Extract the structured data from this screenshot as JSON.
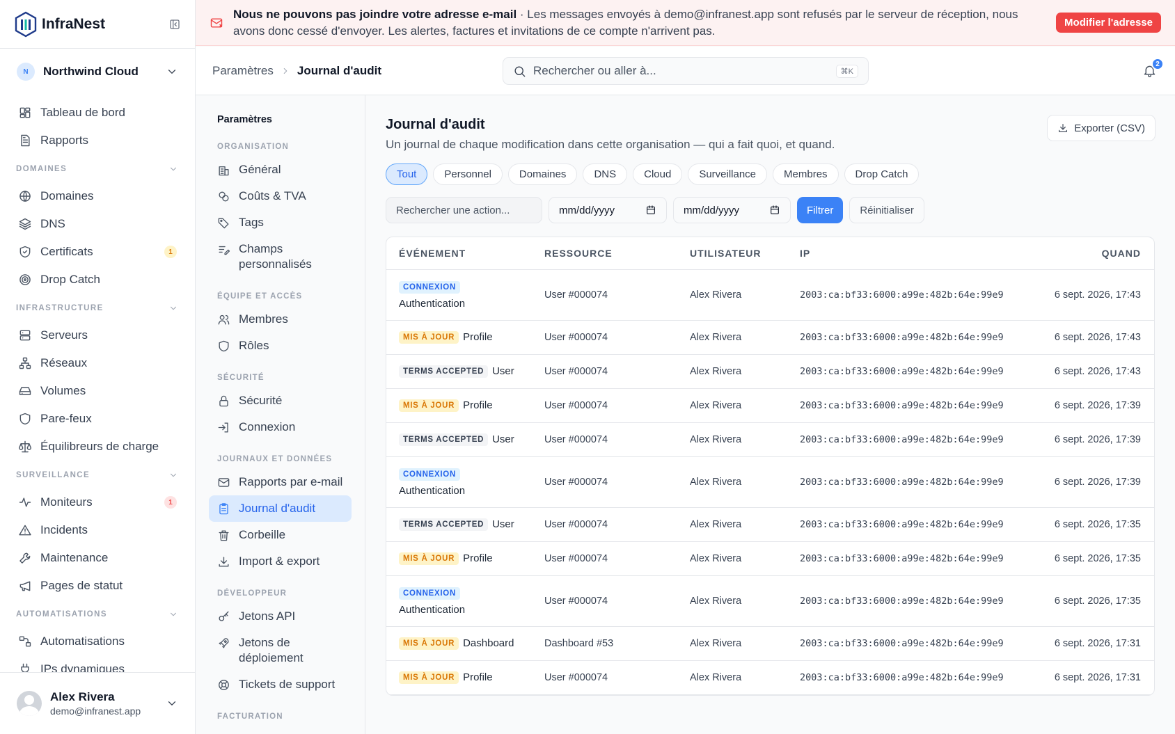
{
  "app": {
    "name": "InfraNest"
  },
  "org": {
    "initial": "N",
    "name": "Northwind Cloud"
  },
  "sidebar": {
    "top": [
      {
        "label": "Tableau de bord",
        "icon": "dashboard-icon"
      },
      {
        "label": "Rapports",
        "icon": "report-icon"
      }
    ],
    "sections": [
      {
        "title": "DOMAINES",
        "items": [
          {
            "label": "Domaines",
            "icon": "globe-icon"
          },
          {
            "label": "DNS",
            "icon": "layers-icon"
          },
          {
            "label": "Certificats",
            "icon": "shield-check-icon",
            "badge": "1",
            "badge_color": "amber"
          },
          {
            "label": "Drop Catch",
            "icon": "target-icon"
          }
        ]
      },
      {
        "title": "INFRASTRUCTURE",
        "items": [
          {
            "label": "Serveurs",
            "icon": "server-icon"
          },
          {
            "label": "Réseaux",
            "icon": "network-icon"
          },
          {
            "label": "Volumes",
            "icon": "drive-icon"
          },
          {
            "label": "Pare-feux",
            "icon": "shield-icon"
          },
          {
            "label": "Équilibreurs de charge",
            "icon": "scale-icon"
          }
        ]
      },
      {
        "title": "SURVEILLANCE",
        "items": [
          {
            "label": "Moniteurs",
            "icon": "activity-icon",
            "badge": "1",
            "badge_color": "red"
          },
          {
            "label": "Incidents",
            "icon": "warning-icon"
          },
          {
            "label": "Maintenance",
            "icon": "wrench-icon"
          },
          {
            "label": "Pages de statut",
            "icon": "megaphone-icon"
          }
        ]
      },
      {
        "title": "AUTOMATISATIONS",
        "items": [
          {
            "label": "Automatisations",
            "icon": "workflow-icon"
          },
          {
            "label": "IPs dynamiques",
            "icon": "plug-icon"
          }
        ]
      }
    ]
  },
  "user": {
    "name": "Alex Rivera",
    "email": "demo@infranest.app"
  },
  "banner": {
    "title": "Nous ne pouvons pas joindre votre adresse e-mail",
    "message": " · Les messages envoyés à demo@infranest.app sont refusés par le serveur de réception, nous avons donc cessé d'envoyer. Les alertes, factures et invitations de ce compte n'arrivent pas.",
    "button": "Modifier l'adresse"
  },
  "breadcrumb": {
    "parent": "Paramètres",
    "current": "Journal d'audit"
  },
  "search": {
    "placeholder": "Rechercher ou aller à...",
    "shortcut": "⌘K"
  },
  "notifications": {
    "count": "2"
  },
  "settings_nav": {
    "title": "Paramètres",
    "groups": [
      {
        "title": "ORGANISATION",
        "items": [
          {
            "label": "Général",
            "icon": "building-icon"
          },
          {
            "label": "Coûts & TVA",
            "icon": "coins-icon"
          },
          {
            "label": "Tags",
            "icon": "tag-icon"
          },
          {
            "label": "Champs personnalisés",
            "icon": "list-edit-icon"
          }
        ]
      },
      {
        "title": "ÉQUIPE ET ACCÈS",
        "items": [
          {
            "label": "Membres",
            "icon": "users-icon"
          },
          {
            "label": "Rôles",
            "icon": "shield-icon"
          }
        ]
      },
      {
        "title": "SÉCURITÉ",
        "items": [
          {
            "label": "Sécurité",
            "icon": "lock-icon"
          },
          {
            "label": "Connexion",
            "icon": "login-icon"
          }
        ]
      },
      {
        "title": "JOURNAUX ET DONNÉES",
        "items": [
          {
            "label": "Rapports par e-mail",
            "icon": "mail-icon"
          },
          {
            "label": "Journal d'audit",
            "icon": "clipboard-icon",
            "active": true
          },
          {
            "label": "Corbeille",
            "icon": "trash-icon"
          },
          {
            "label": "Import & export",
            "icon": "download-icon"
          }
        ]
      },
      {
        "title": "DÉVELOPPEUR",
        "items": [
          {
            "label": "Jetons API",
            "icon": "key-icon"
          },
          {
            "label": "Jetons de déploiement",
            "icon": "rocket-icon"
          },
          {
            "label": "Tickets de support",
            "icon": "lifebuoy-icon"
          }
        ]
      },
      {
        "title": "FACTURATION",
        "items": []
      }
    ]
  },
  "page": {
    "title": "Journal d'audit",
    "description": "Un journal de chaque modification dans cette organisation — qui a fait quoi, et quand.",
    "export_label": "Exporter (CSV)"
  },
  "chips": [
    {
      "label": "Tout",
      "active": true
    },
    {
      "label": "Personnel"
    },
    {
      "label": "Domaines"
    },
    {
      "label": "DNS"
    },
    {
      "label": "Cloud"
    },
    {
      "label": "Surveillance"
    },
    {
      "label": "Membres"
    },
    {
      "label": "Drop Catch"
    }
  ],
  "filters": {
    "action_placeholder": "Rechercher une action...",
    "date_from": "mm/dd/yyyy",
    "date_to": "mm/dd/yyyy",
    "filter_label": "Filtrer",
    "reset_label": "Réinitialiser"
  },
  "table": {
    "headers": {
      "event": "ÉVÉNEMENT",
      "resource": "RESSOURCE",
      "user": "UTILISATEUR",
      "ip": "IP",
      "when": "QUAND"
    },
    "rows": [
      {
        "tag": "CONNEXION",
        "kind": "login",
        "subject": "Authentication",
        "resource": "User #000074",
        "user": "Alex Rivera",
        "ip": "2003:ca:bf33:6000:a99e:482b:64e:99e9",
        "when": "6 sept. 2026, 17:43"
      },
      {
        "tag": "MIS À JOUR",
        "kind": "update",
        "subject": "Profile",
        "resource": "User #000074",
        "user": "Alex Rivera",
        "ip": "2003:ca:bf33:6000:a99e:482b:64e:99e9",
        "when": "6 sept. 2026, 17:43"
      },
      {
        "tag": "TERMS ACCEPTED",
        "kind": "terms",
        "subject": "User",
        "resource": "User #000074",
        "user": "Alex Rivera",
        "ip": "2003:ca:bf33:6000:a99e:482b:64e:99e9",
        "when": "6 sept. 2026, 17:43"
      },
      {
        "tag": "MIS À JOUR",
        "kind": "update",
        "subject": "Profile",
        "resource": "User #000074",
        "user": "Alex Rivera",
        "ip": "2003:ca:bf33:6000:a99e:482b:64e:99e9",
        "when": "6 sept. 2026, 17:39"
      },
      {
        "tag": "TERMS ACCEPTED",
        "kind": "terms",
        "subject": "User",
        "resource": "User #000074",
        "user": "Alex Rivera",
        "ip": "2003:ca:bf33:6000:a99e:482b:64e:99e9",
        "when": "6 sept. 2026, 17:39"
      },
      {
        "tag": "CONNEXION",
        "kind": "login",
        "subject": "Authentication",
        "resource": "User #000074",
        "user": "Alex Rivera",
        "ip": "2003:ca:bf33:6000:a99e:482b:64e:99e9",
        "when": "6 sept. 2026, 17:39"
      },
      {
        "tag": "TERMS ACCEPTED",
        "kind": "terms",
        "subject": "User",
        "resource": "User #000074",
        "user": "Alex Rivera",
        "ip": "2003:ca:bf33:6000:a99e:482b:64e:99e9",
        "when": "6 sept. 2026, 17:35"
      },
      {
        "tag": "MIS À JOUR",
        "kind": "update",
        "subject": "Profile",
        "resource": "User #000074",
        "user": "Alex Rivera",
        "ip": "2003:ca:bf33:6000:a99e:482b:64e:99e9",
        "when": "6 sept. 2026, 17:35"
      },
      {
        "tag": "CONNEXION",
        "kind": "login",
        "subject": "Authentication",
        "resource": "User #000074",
        "user": "Alex Rivera",
        "ip": "2003:ca:bf33:6000:a99e:482b:64e:99e9",
        "when": "6 sept. 2026, 17:35"
      },
      {
        "tag": "MIS À JOUR",
        "kind": "update",
        "subject": "Dashboard",
        "resource": "Dashboard #53",
        "user": "Alex Rivera",
        "ip": "2003:ca:bf33:6000:a99e:482b:64e:99e9",
        "when": "6 sept. 2026, 17:31"
      },
      {
        "tag": "MIS À JOUR",
        "kind": "update",
        "subject": "Profile",
        "resource": "User #000074",
        "user": "Alex Rivera",
        "ip": "2003:ca:bf33:6000:a99e:482b:64e:99e9",
        "when": "6 sept. 2026, 17:31"
      }
    ]
  }
}
